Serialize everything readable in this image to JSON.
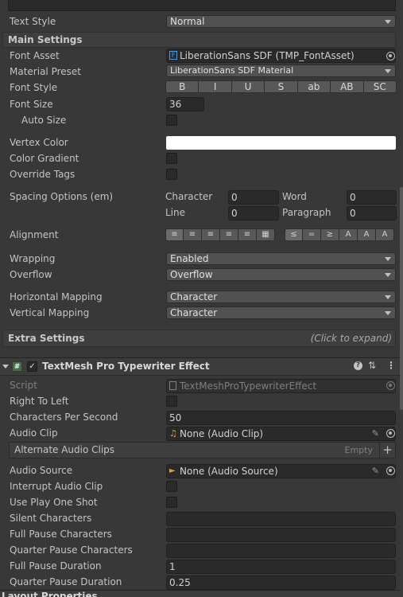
{
  "text_style": {
    "label": "Text Style",
    "value": "Normal"
  },
  "main_settings": {
    "header": "Main Settings",
    "font_asset": {
      "label": "Font Asset",
      "value": "LiberationSans SDF (TMP_FontAsset)"
    },
    "material_preset": {
      "label": "Material Preset",
      "value": "LiberationSans SDF Material"
    },
    "font_style": {
      "label": "Font Style",
      "buttons": [
        "B",
        "I",
        "U",
        "S",
        "ab",
        "AB",
        "SC"
      ]
    },
    "font_size": {
      "label": "Font Size",
      "value": "36"
    },
    "auto_size": {
      "label": "Auto Size"
    },
    "vertex_color": {
      "label": "Vertex Color",
      "color": "#ffffff"
    },
    "color_gradient": {
      "label": "Color Gradient"
    },
    "override_tags": {
      "label": "Override Tags"
    },
    "spacing": {
      "label": "Spacing Options (em)",
      "character": {
        "label": "Character",
        "value": "0"
      },
      "word": {
        "label": "Word",
        "value": "0"
      },
      "line": {
        "label": "Line",
        "value": "0"
      },
      "paragraph": {
        "label": "Paragraph",
        "value": "0"
      }
    },
    "alignment": {
      "label": "Alignment"
    },
    "wrapping": {
      "label": "Wrapping",
      "value": "Enabled"
    },
    "overflow": {
      "label": "Overflow",
      "value": "Overflow"
    },
    "horizontal_mapping": {
      "label": "Horizontal Mapping",
      "value": "Character"
    },
    "vertical_mapping": {
      "label": "Vertical Mapping",
      "value": "Character"
    }
  },
  "extra_settings": {
    "header": "Extra Settings",
    "hint": "(Click to expand)"
  },
  "component": {
    "title": "TextMesh Pro Typewriter Effect",
    "script": {
      "label": "Script",
      "value": "TextMeshProTypewriterEffect"
    },
    "right_to_left": {
      "label": "Right To Left"
    },
    "chars_per_second": {
      "label": "Characters Per Second",
      "value": "50"
    },
    "audio_clip": {
      "label": "Audio Clip",
      "value": "None (Audio Clip)"
    },
    "alternate_clips": {
      "label": "Alternate Audio Clips",
      "empty": "Empty",
      "add": "+"
    },
    "audio_source": {
      "label": "Audio Source",
      "value": "None (Audio Source)"
    },
    "interrupt_audio_clip": {
      "label": "Interrupt Audio Clip"
    },
    "use_play_one_shot": {
      "label": "Use Play One Shot"
    },
    "silent_characters": {
      "label": "Silent Characters",
      "value": ""
    },
    "full_pause_characters": {
      "label": "Full Pause Characters",
      "value": ""
    },
    "quarter_pause_characters": {
      "label": "Quarter Pause Characters",
      "value": ""
    },
    "full_pause_duration": {
      "label": "Full Pause Duration",
      "value": "1"
    },
    "quarter_pause_duration": {
      "label": "Quarter Pause Duration",
      "value": "0.25"
    }
  },
  "next_component": {
    "title": "Layout Properties"
  }
}
